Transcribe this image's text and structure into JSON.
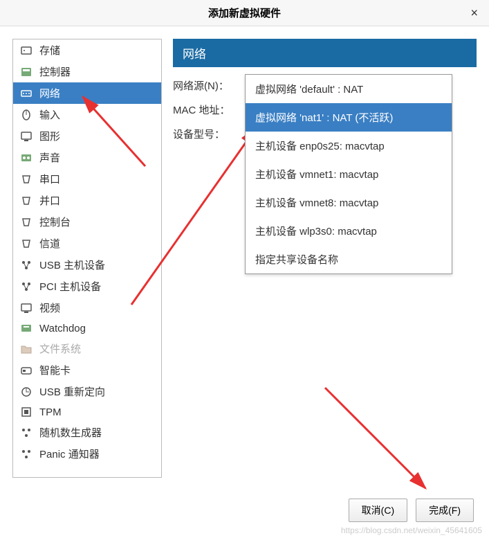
{
  "title": "添加新虚拟硬件",
  "sidebar": {
    "items": [
      {
        "label": "存储",
        "icon": "storage"
      },
      {
        "label": "控制器",
        "icon": "controller"
      },
      {
        "label": "网络",
        "icon": "network",
        "selected": true
      },
      {
        "label": "输入",
        "icon": "input"
      },
      {
        "label": "图形",
        "icon": "graphics"
      },
      {
        "label": "声音",
        "icon": "sound"
      },
      {
        "label": "串口",
        "icon": "serial"
      },
      {
        "label": "并口",
        "icon": "parallel"
      },
      {
        "label": "控制台",
        "icon": "console"
      },
      {
        "label": "信道",
        "icon": "channel"
      },
      {
        "label": "USB 主机设备",
        "icon": "usb"
      },
      {
        "label": "PCI 主机设备",
        "icon": "pci"
      },
      {
        "label": "视频",
        "icon": "video"
      },
      {
        "label": "Watchdog",
        "icon": "watchdog"
      },
      {
        "label": "文件系统",
        "icon": "filesystem",
        "disabled": true
      },
      {
        "label": "智能卡",
        "icon": "smartcard"
      },
      {
        "label": "USB 重新定向",
        "icon": "usbredir"
      },
      {
        "label": "TPM",
        "icon": "tpm"
      },
      {
        "label": "随机数生成器",
        "icon": "rng"
      },
      {
        "label": "Panic 通知器",
        "icon": "panic"
      }
    ]
  },
  "panel": {
    "header": "网络",
    "labels": {
      "source": "网络源(N)：",
      "mac": "MAC 地址：",
      "model": "设备型号："
    },
    "dropdown": [
      {
        "label": "虚拟网络 'default' : NAT"
      },
      {
        "label": "虚拟网络 'nat1' : NAT (不活跃)",
        "selected": true
      },
      {
        "label": "主机设备 enp0s25: macvtap"
      },
      {
        "label": "主机设备 vmnet1: macvtap"
      },
      {
        "label": "主机设备 vmnet8: macvtap"
      },
      {
        "label": "主机设备 wlp3s0: macvtap"
      },
      {
        "label": "指定共享设备名称"
      }
    ]
  },
  "buttons": {
    "cancel": "取消(C)",
    "finish": "完成(F)"
  },
  "watermark": "https://blog.csdn.net/weixin_45641605"
}
